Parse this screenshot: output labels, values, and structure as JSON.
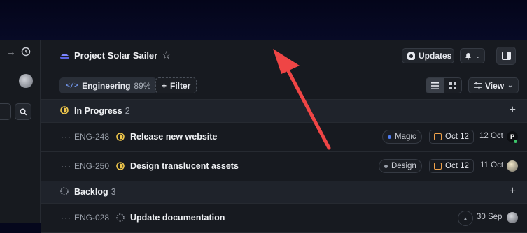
{
  "header": {
    "project_title": "Project Solar Sailer",
    "updates_label": "Updates"
  },
  "toolbar": {
    "team_code_icon": "</>",
    "team_name": "Engineering",
    "team_progress": "89%",
    "filter_label": "Filter",
    "view_label": "View"
  },
  "groups": [
    {
      "title": "In Progress",
      "count": "2",
      "color": "#f2c94c"
    },
    {
      "title": "Backlog",
      "count": "3",
      "color": "#9aa0aa"
    }
  ],
  "issues": [
    {
      "id": "ENG-248",
      "title": "Release new website",
      "label": "Magic",
      "label_color": "#4f7df3",
      "due": "Oct 12",
      "date": "12 Oct",
      "avatar": "P"
    },
    {
      "id": "ENG-250",
      "title": "Design translucent assets",
      "label": "Design",
      "label_color": "#9aa0aa",
      "due": "Oct 12",
      "date": "11 Oct",
      "avatar": ""
    },
    {
      "id": "ENG-028",
      "title": "Update documentation",
      "date": "30 Sep",
      "avatar": ""
    }
  ],
  "colors": {
    "accent": "#ef4545",
    "status_in_progress": "#f2c94c",
    "due_icon": "#f0a24a"
  }
}
